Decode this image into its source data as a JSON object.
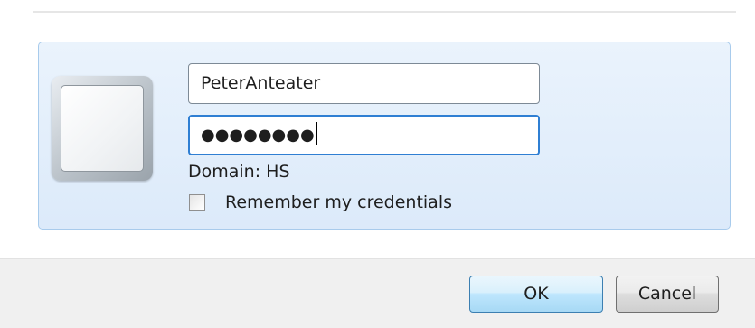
{
  "credentials": {
    "username_value": "PeterAnteater",
    "password_mask": "●●●●●●●●",
    "domain_label": "Domain: HS",
    "remember_label": "Remember my credentials",
    "remember_checked": false,
    "user_tile_icon": "user-tile-icon"
  },
  "buttons": {
    "ok_label": "OK",
    "cancel_label": "Cancel"
  },
  "colors": {
    "tile_border": "#a8cbec",
    "tile_background": "#dceafa",
    "focus_border": "#2f7fd3",
    "ok_border": "#3c7fb1"
  }
}
